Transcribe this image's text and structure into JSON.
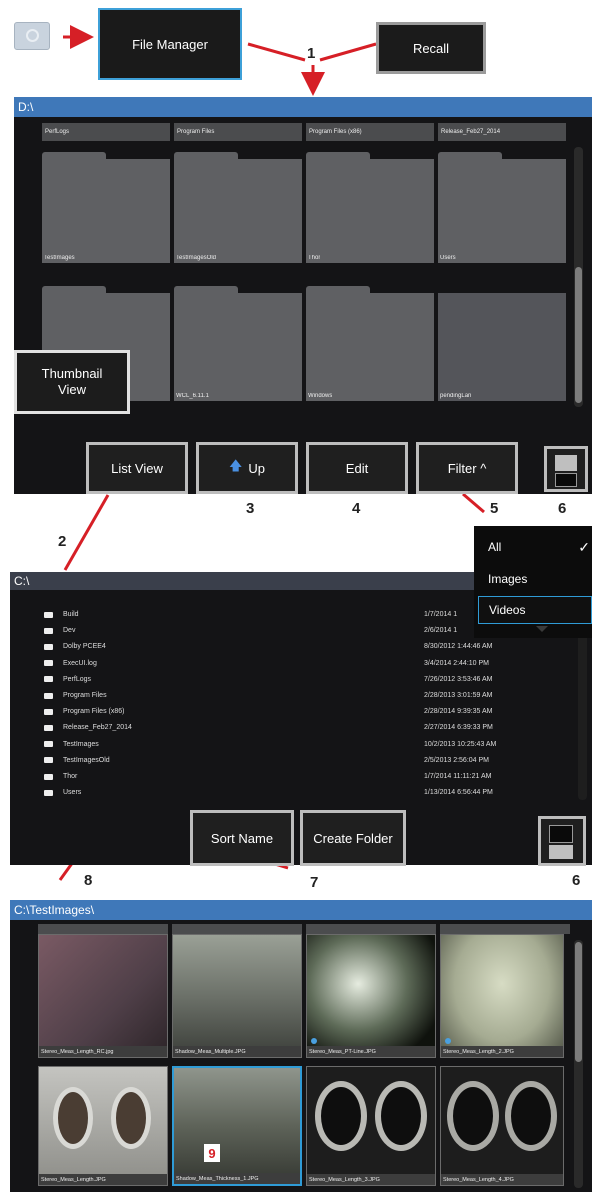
{
  "top": {
    "file_manager_label": "File Manager",
    "recall_label": "Recall"
  },
  "callouts": [
    "1",
    "2",
    "3",
    "4",
    "5",
    "6",
    "7",
    "8",
    "6",
    "9"
  ],
  "pane1": {
    "path": "D:\\",
    "header_folders": [
      "PerfLogs",
      "Program Files",
      "Program Files (x86)",
      "Release_Feb27_2014"
    ],
    "row1": [
      "TestImages",
      "TestImagesOld",
      "Thor",
      "Users"
    ],
    "row2": [
      "",
      "WCL_6.11.1",
      "Windows",
      "pendingLan"
    ],
    "thumbnail_view_label": "Thumbnail View",
    "buttons": {
      "list_view": "List View",
      "up": "Up",
      "edit": "Edit",
      "filter": "Filter ^"
    }
  },
  "filter_menu": {
    "items": [
      "All",
      "Images",
      "Videos"
    ],
    "check": "✓"
  },
  "pane2": {
    "path": "C:\\",
    "rows": [
      {
        "name": "Build",
        "date": "1/7/2014 1"
      },
      {
        "name": "Dev",
        "date": "2/6/2014 1"
      },
      {
        "name": "Dolby PCEE4",
        "date": "8/30/2012 1:44:46 AM"
      },
      {
        "name": "ExecUI.log",
        "date": "3/4/2014 2:44:10 PM"
      },
      {
        "name": "PerfLogs",
        "date": "7/26/2012 3:53:46 AM"
      },
      {
        "name": "Program Files",
        "date": "2/28/2013 3:01:59 AM"
      },
      {
        "name": "Program Files (x86)",
        "date": "2/28/2014 9:39:35 AM"
      },
      {
        "name": "Release_Feb27_2014",
        "date": "2/27/2014 6:39:33 PM"
      },
      {
        "name": "TestImages",
        "date": "10/2/2013 10:25:43 AM"
      },
      {
        "name": "TestImagesOld",
        "date": "2/5/2013 2:56:04 PM"
      },
      {
        "name": "Thor",
        "date": "1/7/2014 11:11:21 AM"
      },
      {
        "name": "Users",
        "date": "1/13/2014 6:56:44 PM"
      }
    ],
    "buttons": {
      "sort_name": "Sort Name",
      "create_folder": "Create Folder"
    }
  },
  "pane3": {
    "path": "C:\\TestImages\\",
    "thumbs_row1": [
      "Stereo_Meas_Length_RC.jpg",
      "Shadow_Meas_Multiple.JPG",
      "Stereo_Meas_PT-Line.JPG",
      "Stereo_Meas_Length_2.JPG"
    ],
    "thumbs_row2": [
      "Stereo_Meas_Length.JPG",
      "Shadow_Meas_Thickness_1.JPG",
      "Stereo_Meas_Length_3.JPG",
      "Stereo_Meas_Length_4.JPG"
    ],
    "selected_badge": "9"
  },
  "colors": {
    "titlebar": "#3f78b9",
    "panel": "#141416",
    "arrow": "#d61f26",
    "highlight": "#2f9bd6"
  }
}
